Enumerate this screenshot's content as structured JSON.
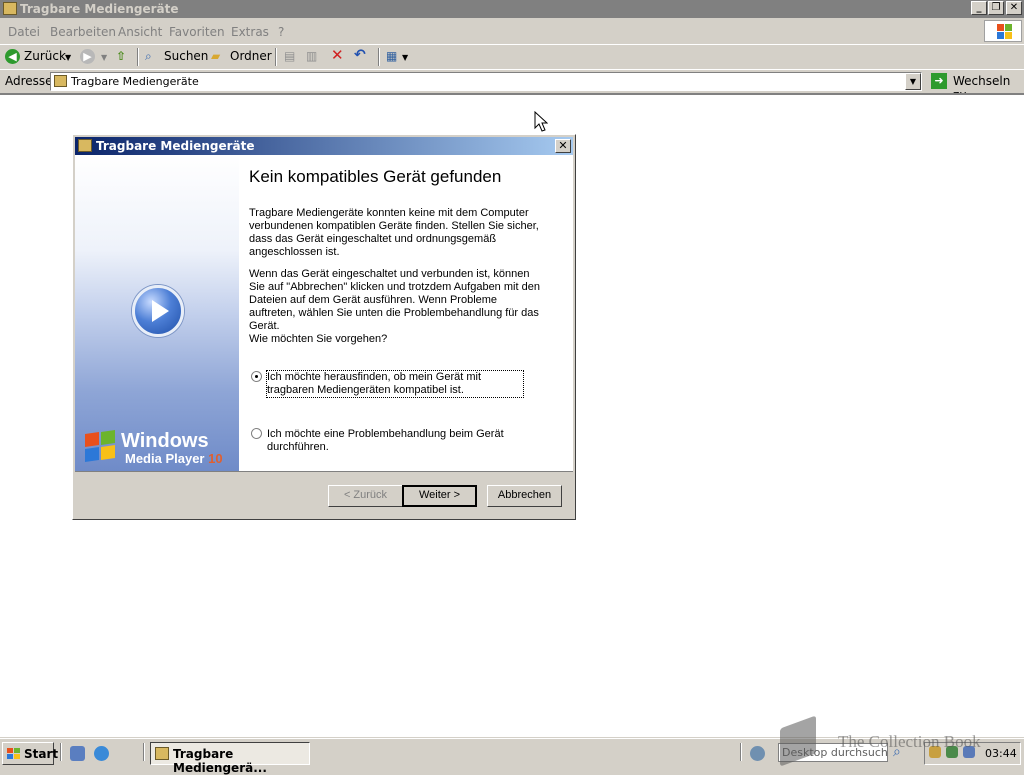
{
  "window": {
    "title": "Tragbare Mediengeräte"
  },
  "menu": [
    "Datei",
    "Bearbeiten",
    "Ansicht",
    "Favoriten",
    "Extras",
    "?"
  ],
  "toolbar": {
    "back": "Zurück",
    "search": "Suchen",
    "folders": "Ordner"
  },
  "address": {
    "label": "Adresse",
    "value": "Tragbare Mediengeräte",
    "go": "Wechseln zu"
  },
  "dialog": {
    "title": "Tragbare Mediengeräte",
    "heading": "Kein kompatibles Gerät gefunden",
    "para1": "Tragbare Mediengeräte konnten keine mit dem Computer verbundenen kompatiblen Geräte finden. Stellen Sie sicher, dass das Gerät eingeschaltet und ordnungsgemäß angeschlossen ist.",
    "para2": "Wenn das Gerät eingeschaltet und verbunden ist, können Sie auf \"Abbrechen\" klicken und trotzdem Aufgaben mit den Dateien auf dem Gerät ausführen. Wenn Probleme auftreten, wählen Sie unten die Problembehandlung für das Gerät.",
    "question": "Wie möchten Sie vorgehen?",
    "option1": "Ich möchte herausfinden, ob mein Gerät mit tragbaren Mediengeräten kompatibel ist.",
    "option2": "Ich möchte eine Problembehandlung beim Gerät durchführen.",
    "selected_option": 1,
    "brand_windows": "Windows",
    "brand_player": "Media Player",
    "brand_version": "10",
    "buttons": {
      "back": "< Zurück",
      "next": "Weiter >",
      "cancel": "Abbrechen"
    }
  },
  "taskbar": {
    "start": "Start",
    "task": "Tragbare Mediengerä...",
    "search_placeholder": "Desktop durchsuchen",
    "clock": "03:44"
  },
  "watermark": "The Collection Book"
}
